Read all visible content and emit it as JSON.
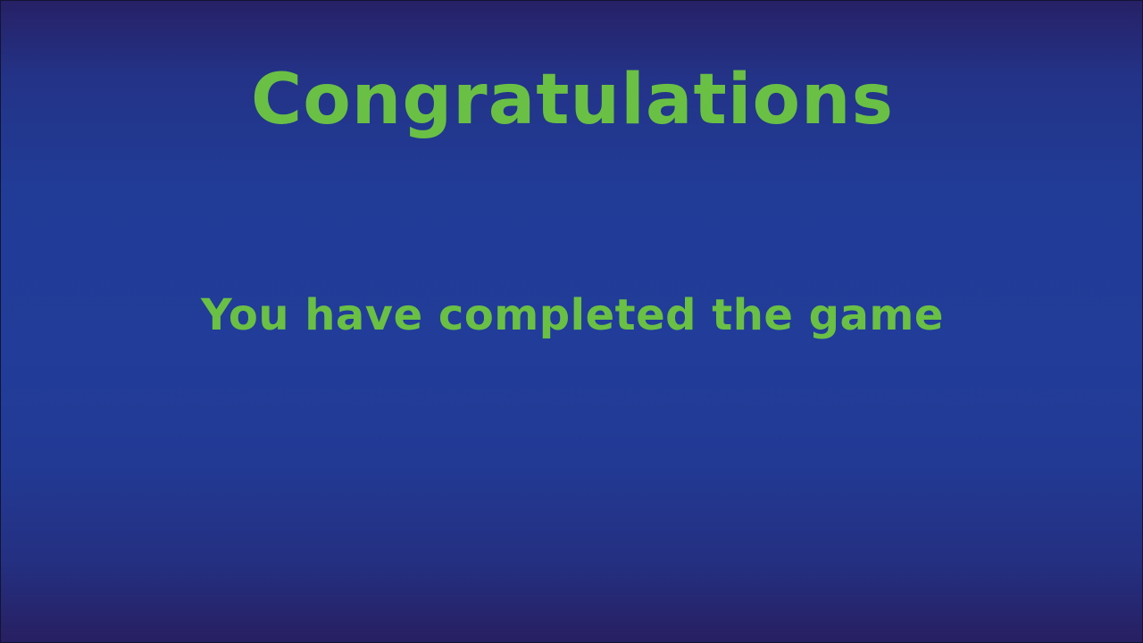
{
  "screen": {
    "title": "Congratulations",
    "message": "You have completed the game"
  },
  "colors": {
    "text": "#6abf45",
    "background_top": "#272066",
    "background_mid": "#213d99",
    "background_bottom": "#281f62"
  }
}
